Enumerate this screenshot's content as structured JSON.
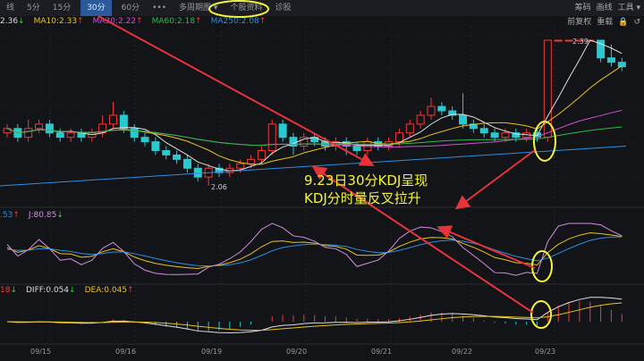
{
  "toolbar": {
    "items": [
      "线",
      "5分",
      "15分",
      "30分",
      "60分",
      "•••",
      "多周期图 ▾",
      "个股资料",
      "诊股"
    ],
    "active": "30分",
    "right": [
      "筹码",
      "画线",
      "工具 ▾"
    ],
    "right2": [
      "前复权",
      "重载",
      "🔒",
      "↺"
    ]
  },
  "ma_legend": [
    {
      "text": "2.36",
      "arrow": "↓",
      "color": "#dddddd",
      "dir": "dn"
    },
    {
      "text": "MA10:2.33",
      "arrow": "↑",
      "color": "#e8c21e",
      "dir": "up"
    },
    {
      "text": "MA30:2.22",
      "arrow": "↑",
      "color": "#d04fd0",
      "dir": "up"
    },
    {
      "text": "MA60:2.18",
      "arrow": "↑",
      "color": "#2dbb4a",
      "dir": "up"
    },
    {
      "text": "MA250:2.08",
      "arrow": "↑",
      "color": "#2a8fe0",
      "dir": "up"
    }
  ],
  "kdj_legend": [
    {
      "text": ".53",
      "arrow": "↑",
      "color": "#2a8fe0",
      "dir": "up"
    },
    {
      "text": "J:80.85",
      "arrow": "↓",
      "color": "#d28fe0",
      "dir": "dn"
    }
  ],
  "macd_legend": [
    {
      "text": "18",
      "arrow": "↓",
      "color": "#f33",
      "dir": "dn"
    },
    {
      "text": "DIFF:0.054",
      "arrow": "↓",
      "color": "#dddddd",
      "dir": "dn"
    },
    {
      "text": "DEA:0.045",
      "arrow": "↑",
      "color": "#e8c21e",
      "dir": "up"
    }
  ],
  "annotation": {
    "line1": "9.23日30分KDJ呈现",
    "line2": "KDJ分时量反叉拉升"
  },
  "chart_data": {
    "type": "candlestick",
    "dates": [
      "09/15",
      "09/16",
      "09/19",
      "09/20",
      "09/21",
      "09/22",
      "09/23"
    ],
    "high_label": "2.39",
    "low_label": "2.06",
    "ylim": [
      2.02,
      2.41
    ],
    "ma250": [
      2.06,
      2.15
    ],
    "ohlc": [
      [
        2.18,
        2.19,
        2.2,
        2.17
      ],
      [
        2.19,
        2.17,
        2.2,
        2.16
      ],
      [
        2.17,
        2.19,
        2.21,
        2.16
      ],
      [
        2.19,
        2.2,
        2.21,
        2.18
      ],
      [
        2.2,
        2.18,
        2.21,
        2.17
      ],
      [
        2.18,
        2.17,
        2.19,
        2.16
      ],
      [
        2.17,
        2.18,
        2.19,
        2.16
      ],
      [
        2.18,
        2.17,
        2.19,
        2.16
      ],
      [
        2.17,
        2.18,
        2.19,
        2.16
      ],
      [
        2.18,
        2.2,
        2.22,
        2.17
      ],
      [
        2.2,
        2.22,
        2.25,
        2.19
      ],
      [
        2.22,
        2.19,
        2.23,
        2.18
      ],
      [
        2.19,
        2.17,
        2.2,
        2.16
      ],
      [
        2.17,
        2.16,
        2.18,
        2.15
      ],
      [
        2.16,
        2.14,
        2.17,
        2.13
      ],
      [
        2.14,
        2.13,
        2.15,
        2.12
      ],
      [
        2.13,
        2.12,
        2.14,
        2.11
      ],
      [
        2.12,
        2.1,
        2.13,
        2.09
      ],
      [
        2.1,
        2.08,
        2.11,
        2.07
      ],
      [
        2.08,
        2.1,
        2.11,
        2.06
      ],
      [
        2.1,
        2.09,
        2.11,
        2.08
      ],
      [
        2.09,
        2.1,
        2.11,
        2.08
      ],
      [
        2.1,
        2.11,
        2.12,
        2.09
      ],
      [
        2.11,
        2.12,
        2.13,
        2.1
      ],
      [
        2.12,
        2.14,
        2.15,
        2.11
      ],
      [
        2.14,
        2.2,
        2.21,
        2.13
      ],
      [
        2.2,
        2.17,
        2.21,
        2.16
      ],
      [
        2.17,
        2.15,
        2.18,
        2.13
      ],
      [
        2.15,
        2.17,
        2.18,
        2.14
      ],
      [
        2.17,
        2.16,
        2.18,
        2.15
      ],
      [
        2.16,
        2.15,
        2.17,
        2.14
      ],
      [
        2.15,
        2.16,
        2.17,
        2.14
      ],
      [
        2.16,
        2.15,
        2.17,
        2.13
      ],
      [
        2.15,
        2.14,
        2.16,
        2.13
      ],
      [
        2.14,
        2.16,
        2.17,
        2.13
      ],
      [
        2.16,
        2.15,
        2.17,
        2.14
      ],
      [
        2.15,
        2.16,
        2.17,
        2.14
      ],
      [
        2.16,
        2.18,
        2.19,
        2.15
      ],
      [
        2.18,
        2.2,
        2.21,
        2.17
      ],
      [
        2.2,
        2.22,
        2.23,
        2.19
      ],
      [
        2.22,
        2.24,
        2.26,
        2.21
      ],
      [
        2.24,
        2.23,
        2.25,
        2.22
      ],
      [
        2.23,
        2.22,
        2.24,
        2.21
      ],
      [
        2.22,
        2.2,
        2.27,
        2.19
      ],
      [
        2.2,
        2.19,
        2.21,
        2.18
      ],
      [
        2.19,
        2.18,
        2.2,
        2.17
      ],
      [
        2.18,
        2.17,
        2.19,
        2.16
      ],
      [
        2.17,
        2.18,
        2.19,
        2.16
      ],
      [
        2.18,
        2.17,
        2.19,
        2.16
      ],
      [
        2.17,
        2.18,
        2.19,
        2.16
      ],
      [
        2.18,
        2.17,
        2.19,
        2.16
      ],
      [
        2.17,
        2.39,
        2.39,
        2.16
      ],
      [
        2.39,
        2.39,
        2.39,
        2.39
      ],
      [
        2.39,
        2.39,
        2.39,
        2.39
      ],
      [
        2.39,
        2.39,
        2.39,
        2.39
      ],
      [
        2.39,
        2.39,
        2.39,
        2.39
      ],
      [
        2.39,
        2.35,
        2.39,
        2.34
      ],
      [
        2.35,
        2.34,
        2.38,
        2.33
      ],
      [
        2.34,
        2.33,
        2.35,
        2.32
      ]
    ]
  }
}
